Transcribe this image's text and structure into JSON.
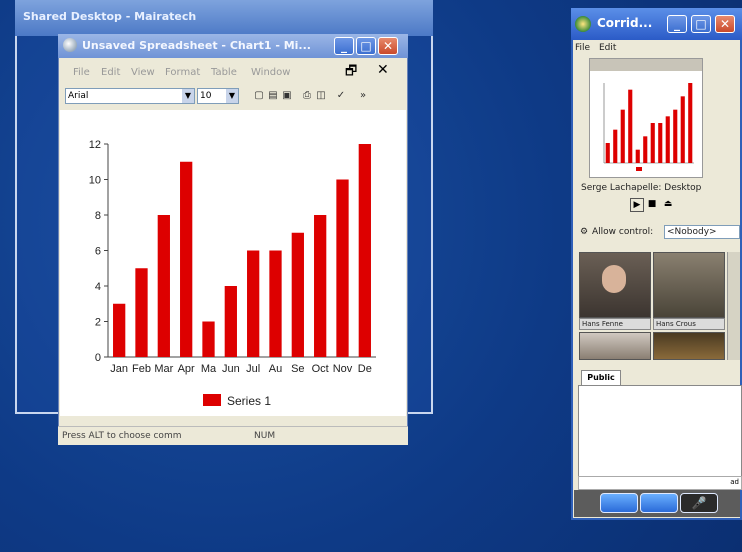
{
  "shared_window": {
    "title": "Shared Desktop - Mairatech"
  },
  "spreadsheet_window": {
    "title": "Unsaved Spreadsheet - Chart1 - Mi...",
    "menu": [
      "File",
      "Edit",
      "View",
      "Format",
      "Table",
      "Window"
    ],
    "font_name": "Arial",
    "font_size": "10",
    "status_left": "Press ALT to choose comm",
    "status_mode": "NUM"
  },
  "chart_data": {
    "type": "bar",
    "categories": [
      "Jan",
      "Feb",
      "Mar",
      "Apr",
      "Ma",
      "Jun",
      "Jul",
      "Au",
      "Se",
      "Oct",
      "Nov",
      "De"
    ],
    "series": [
      {
        "name": "Series 1",
        "values": [
          3,
          5,
          8,
          11,
          2,
          4,
          6,
          6,
          7,
          8,
          10,
          12
        ],
        "color": "#dd0000"
      }
    ],
    "yticks": [
      "0",
      "2",
      "4",
      "6",
      "8",
      "10",
      "12"
    ],
    "ylim": [
      0,
      12
    ],
    "legend": "bottom"
  },
  "corridor_window": {
    "title": "Corrid...",
    "menu": [
      "File",
      "Edit"
    ],
    "presenter": "Serge Lachapelle: Desktop",
    "allow_control_label": "Allow control:",
    "allow_control_value": "<Nobody>",
    "participants": [
      {
        "name": "Hans Fenne",
        "tone": "#7a6a58"
      },
      {
        "name": "Hans Crous",
        "tone": "#5b5448"
      }
    ],
    "chat_tab": "Public",
    "input_partial": "ad"
  }
}
